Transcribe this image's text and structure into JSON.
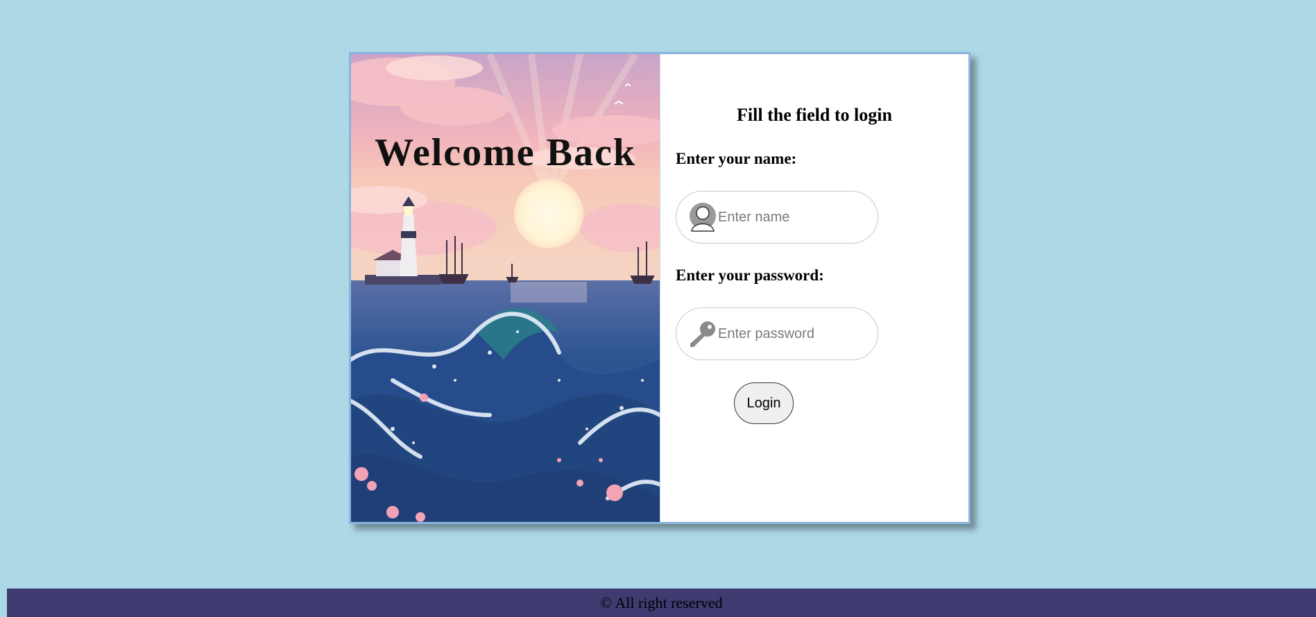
{
  "hero": {
    "title": "Welcome Back",
    "image": "ocean-lighthouse-sunset"
  },
  "form": {
    "title": "Fill the field to login",
    "name_label": "Enter your name:",
    "name_placeholder": "Enter name",
    "name_icon": "user-icon",
    "password_label": "Enter your password:",
    "password_placeholder": "Enter password",
    "password_icon": "key-icon",
    "login_label": "Login"
  },
  "footer": {
    "text": "© All right reserved"
  },
  "colors": {
    "page_background": "#add8e6",
    "footer_background": "#3f3a70",
    "card_border": "#8ab4dc"
  }
}
